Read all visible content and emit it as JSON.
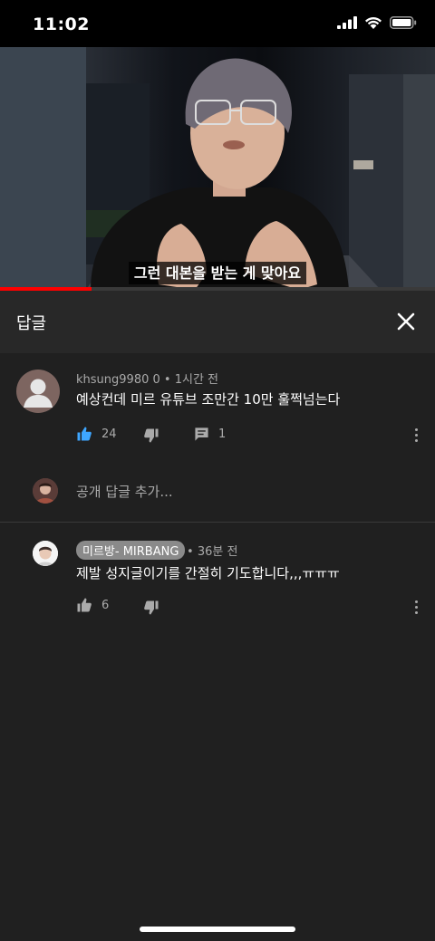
{
  "status_bar": {
    "time": "11:02"
  },
  "video": {
    "subtitle": "그런 대본을 받는 게 맞아요",
    "progress": 0.21
  },
  "panel": {
    "title": "답글"
  },
  "main_comment": {
    "author": "khsung9980 0",
    "time": "1시간 전",
    "text": "예상컨데 미르 유튜브 조만간 10만 훌쩍넘는다",
    "likes": "24",
    "replies": "1"
  },
  "add_reply": {
    "placeholder": "공개 답글 추가..."
  },
  "reply": {
    "author": "미르방- MIRBANG",
    "time": "36분 전",
    "text": "제발 성지글이기를 간절히 기도합니다,,,ㅠㅠㅠ",
    "likes": "6"
  },
  "icons": {
    "signal": "cellular-signal-icon",
    "wifi": "wifi-icon",
    "battery": "battery-icon",
    "close": "close-icon",
    "like": "thumbs-up-icon",
    "dislike": "thumbs-down-icon",
    "comment": "comment-icon",
    "menu": "kebab-menu-icon"
  },
  "colors": {
    "accent_like": "#3ea6ff",
    "progress": "#ff0000",
    "background": "#202020"
  }
}
